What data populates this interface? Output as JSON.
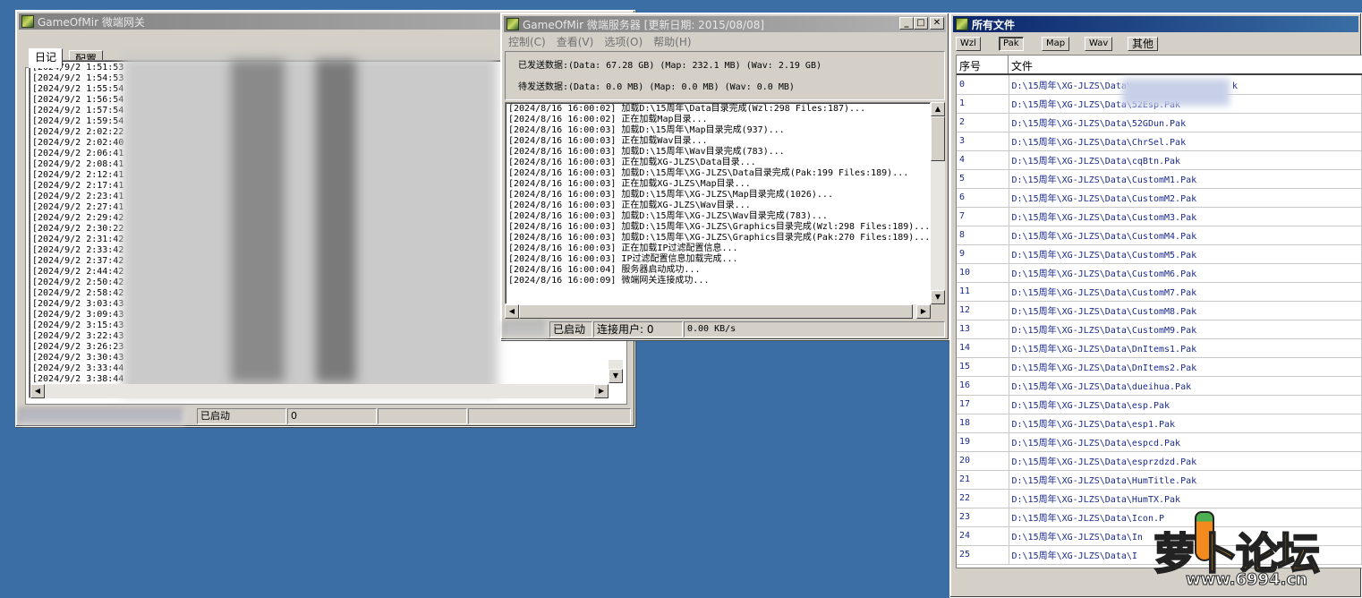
{
  "gateway_window": {
    "title": "GameOfMir  微端网关",
    "tabs": [
      "日记",
      "配置"
    ],
    "log_lines": [
      "[2024/9/2 1:51:53",
      "[2024/9/2 1:54:53",
      "[2024/9/2 1:55:54",
      "[2024/9/2 1:56:54",
      "[2024/9/2 1:57:54",
      "[2024/9/2 1:59:54",
      "[2024/9/2 2:02:22",
      "[2024/9/2 2:02:40",
      "[2024/9/2 2:06:41",
      "[2024/9/2 2:08:41",
      "[2024/9/2 2:12:41",
      "[2024/9/2 2:17:41",
      "[2024/9/2 2:23:41",
      "[2024/9/2 2:27:41",
      "[2024/9/2 2:29:42",
      "[2024/9/2 2:30:22",
      "[2024/9/2 2:31:42",
      "[2024/9/2 2:33:42",
      "[2024/9/2 2:37:42",
      "[2024/9/2 2:44:42",
      "[2024/9/2 2:50:42",
      "[2024/9/2 2:58:42",
      "[2024/9/2 3:03:43",
      "[2024/9/2 3:09:43",
      "[2024/9/2 3:15:43",
      "[2024/9/2 3:22:43",
      "[2024/9/2 3:26:23",
      "[2024/9/2 3:30:43",
      "[2024/9/2 3:33:44",
      "[2024/9/2 3:38:44"
    ],
    "status": {
      "state": "已启动",
      "count": "0"
    }
  },
  "server_window": {
    "title": "GameOfMir  微端服务器 [更新日期: 2015/08/08]",
    "menu": [
      "控制(C)",
      "查看(V)",
      "选项(O)",
      "帮助(H)"
    ],
    "sent_line": "已发送数据:(Data: 67.28 GB) (Map: 232.1 MB) (Wav: 2.19 GB)",
    "pending_line": "待发送数据:(Data: 0.0 MB) (Map: 0.0 MB) (Wav: 0.0 MB)",
    "log_lines": [
      "[2024/8/16 16:00:02] 加载D:\\15周年\\Data目录完成(Wzl:298 Files:187)...",
      "[2024/8/16 16:00:02] 正在加载Map目录...",
      "[2024/8/16 16:00:03] 加载D:\\15周年\\Map目录完成(937)...",
      "[2024/8/16 16:00:03] 正在加载Wav目录...",
      "[2024/8/16 16:00:03] 加载D:\\15周年\\Wav目录完成(783)...",
      "[2024/8/16 16:00:03] 正在加载XG-JLZS\\Data目录...",
      "[2024/8/16 16:00:03] 加载D:\\15周年\\XG-JLZS\\Data目录完成(Pak:199 Files:189)...",
      "[2024/8/16 16:00:03] 正在加载XG-JLZS\\Map目录...",
      "[2024/8/16 16:00:03] 加载D:\\15周年\\XG-JLZS\\Map目录完成(1026)...",
      "[2024/8/16 16:00:03] 正在加载XG-JLZS\\Wav目录...",
      "[2024/8/16 16:00:03] 加载D:\\15周年\\XG-JLZS\\Wav目录完成(783)...",
      "[2024/8/16 16:00:03] 加载D:\\15周年\\XG-JLZS\\Graphics目录完成(Wzl:298 Files:189)...",
      "[2024/8/16 16:00:03] 加载D:\\15周年\\XG-JLZS\\Graphics目录完成(Pak:270 Files:189)...",
      "[2024/8/16 16:00:03] 正在加载IP过滤配置信息...",
      "[2024/8/16 16:00:03] IP过滤配置信息加载完成...",
      "[2024/8/16 16:00:04] 服务器启动成功...",
      "[2024/8/16 16:00:09] 微端网关连接成功..."
    ],
    "status": {
      "state": "已启动",
      "users": "连接用户: 0",
      "speed": "0.00 KB/s"
    }
  },
  "files_window": {
    "title": "所有文件",
    "tabs": [
      "Wzl",
      "Pak",
      "Map",
      "Wav",
      "其他"
    ],
    "active_tab": "Pak",
    "headers": [
      "序号",
      "文件"
    ],
    "rows": [
      [
        "0",
        "D:\\15周年\\XG-JLZS\\Data\\"
      ],
      [
        "1",
        "D:\\15周年\\XG-JLZS\\Data\\52Esp.Pak"
      ],
      [
        "2",
        "D:\\15周年\\XG-JLZS\\Data\\52GDun.Pak"
      ],
      [
        "3",
        "D:\\15周年\\XG-JLZS\\Data\\ChrSel.Pak"
      ],
      [
        "4",
        "D:\\15周年\\XG-JLZS\\Data\\cqBtn.Pak"
      ],
      [
        "5",
        "D:\\15周年\\XG-JLZS\\Data\\CustomM1.Pak"
      ],
      [
        "6",
        "D:\\15周年\\XG-JLZS\\Data\\CustomM2.Pak"
      ],
      [
        "7",
        "D:\\15周年\\XG-JLZS\\Data\\CustomM3.Pak"
      ],
      [
        "8",
        "D:\\15周年\\XG-JLZS\\Data\\CustomM4.Pak"
      ],
      [
        "9",
        "D:\\15周年\\XG-JLZS\\Data\\CustomM5.Pak"
      ],
      [
        "10",
        "D:\\15周年\\XG-JLZS\\Data\\CustomM6.Pak"
      ],
      [
        "11",
        "D:\\15周年\\XG-JLZS\\Data\\CustomM7.Pak"
      ],
      [
        "12",
        "D:\\15周年\\XG-JLZS\\Data\\CustomM8.Pak"
      ],
      [
        "13",
        "D:\\15周年\\XG-JLZS\\Data\\CustomM9.Pak"
      ],
      [
        "14",
        "D:\\15周年\\XG-JLZS\\Data\\DnItems1.Pak"
      ],
      [
        "15",
        "D:\\15周年\\XG-JLZS\\Data\\DnItems2.Pak"
      ],
      [
        "16",
        "D:\\15周年\\XG-JLZS\\Data\\dueihua.Pak"
      ],
      [
        "17",
        "D:\\15周年\\XG-JLZS\\Data\\esp.Pak"
      ],
      [
        "18",
        "D:\\15周年\\XG-JLZS\\Data\\esp1.Pak"
      ],
      [
        "19",
        "D:\\15周年\\XG-JLZS\\Data\\espcd.Pak"
      ],
      [
        "20",
        "D:\\15周年\\XG-JLZS\\Data\\esprzdzd.Pak"
      ],
      [
        "21",
        "D:\\15周年\\XG-JLZS\\Data\\HumTitle.Pak"
      ],
      [
        "22",
        "D:\\15周年\\XG-JLZS\\Data\\HumTX.Pak"
      ],
      [
        "23",
        "D:\\15周年\\XG-JLZS\\Data\\Icon.P"
      ],
      [
        "24",
        "D:\\15周年\\XG-JLZS\\Data\\In"
      ],
      [
        "25",
        "D:\\15周年\\XG-JLZS\\Data\\I"
      ]
    ],
    "row0_suffix": "k"
  },
  "watermark": {
    "brand": "萝卜论坛",
    "url": "www.6994.cn"
  }
}
